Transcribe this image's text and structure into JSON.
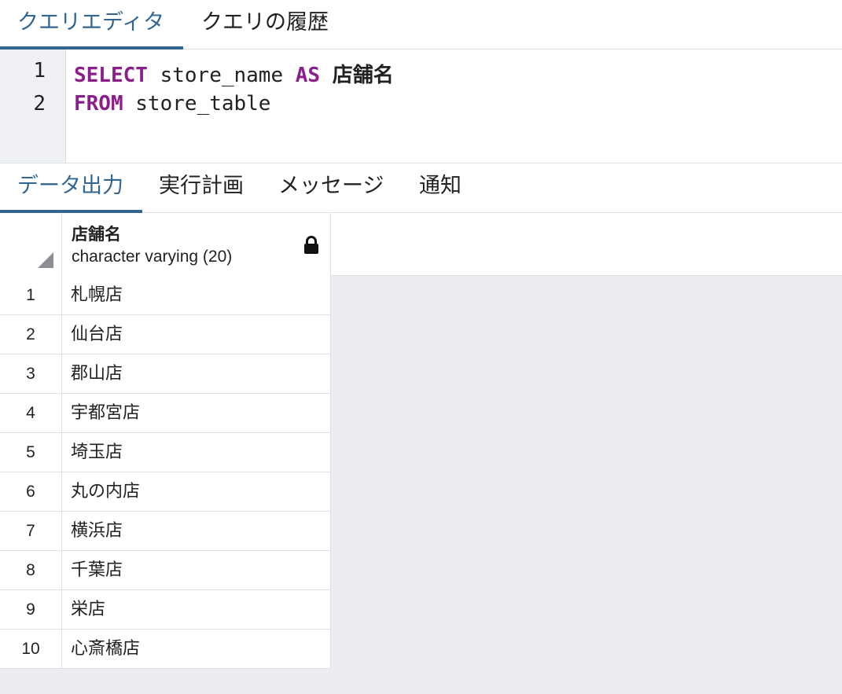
{
  "editor_tabs": [
    {
      "label": "クエリエディタ",
      "active": true
    },
    {
      "label": "クエリの履歴",
      "active": false
    }
  ],
  "editor": {
    "lines": [
      {
        "number": "1",
        "tokens": [
          "SELECT",
          " store_name ",
          "AS",
          " ",
          "店舗名"
        ]
      },
      {
        "number": "2",
        "tokens": [
          "FROM",
          " store_table"
        ]
      }
    ]
  },
  "output_tabs": [
    {
      "label": "データ出力",
      "active": true
    },
    {
      "label": "実行計画",
      "active": false
    },
    {
      "label": "メッセージ",
      "active": false
    },
    {
      "label": "通知",
      "active": false
    }
  ],
  "grid": {
    "column": {
      "name": "店舗名",
      "type": "character varying (20)",
      "icon": "lock-icon"
    },
    "rows": [
      {
        "no": "1",
        "value": "札幌店"
      },
      {
        "no": "2",
        "value": "仙台店"
      },
      {
        "no": "3",
        "value": "郡山店"
      },
      {
        "no": "4",
        "value": "宇都宮店"
      },
      {
        "no": "5",
        "value": "埼玉店"
      },
      {
        "no": "6",
        "value": "丸の内店"
      },
      {
        "no": "7",
        "value": "横浜店"
      },
      {
        "no": "8",
        "value": "千葉店"
      },
      {
        "no": "9",
        "value": "栄店"
      },
      {
        "no": "10",
        "value": "心斎橋店"
      }
    ]
  },
  "colors": {
    "accent": "#326690",
    "keyword": "#8a1e8a",
    "grid_background": "#ebedf1",
    "gutter": "#f0f1f4"
  }
}
